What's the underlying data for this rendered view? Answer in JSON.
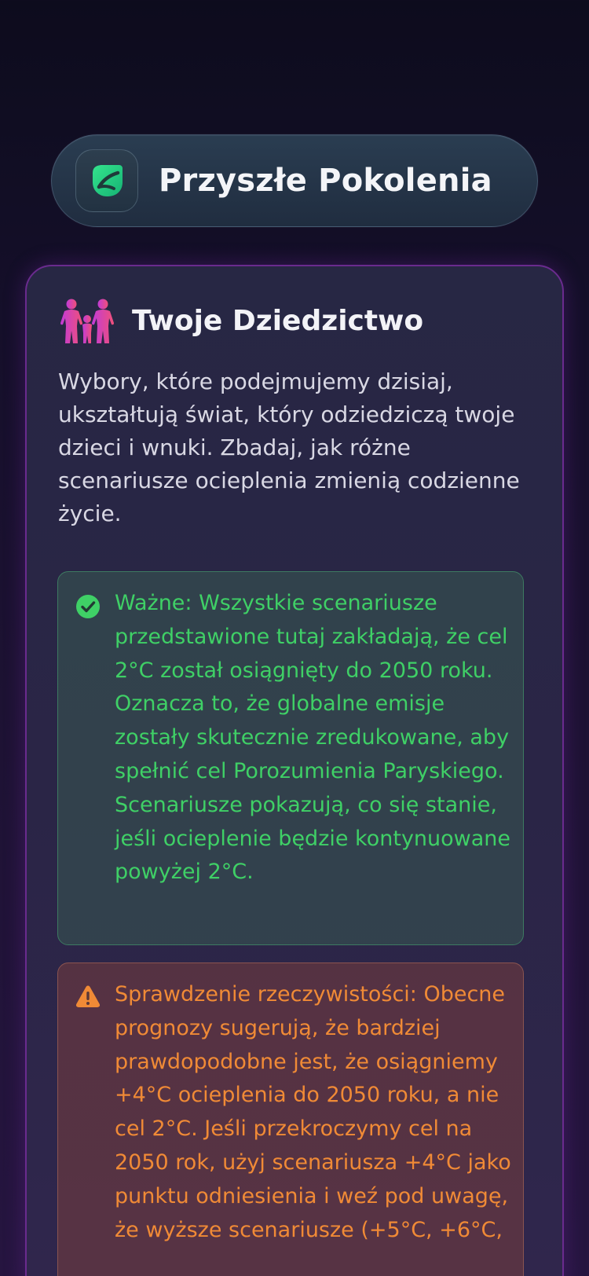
{
  "header": {
    "app_icon": "leaf-icon",
    "title": "Przyszłe Pokolenia"
  },
  "legacy_card": {
    "icon": "family-icon",
    "title": "Twoje Dziedzictwo",
    "description": "Wybory, które podejmujemy dzisiaj, ukształtują świat, który odziedziczą twoje dzieci i wnuki. Zbadaj, jak różne scenariusze ocieplenia zmienią codzienne życie.",
    "important_notice": {
      "icon": "check-circle-icon",
      "text": "Ważne: Wszystkie scenariusze przedstawione tutaj zakładają, że cel 2°C został osiągnięty do 2050 roku. Oznacza to, że globalne emisje zostały skutecznie zredukowane, aby spełnić cel Porozumienia Paryskiego. Scenariusze pokazują, co się stanie, jeśli ocieplenie będzie kontynuowane powyżej 2°C."
    },
    "reality_notice": {
      "icon": "warning-triangle-icon",
      "text": "Sprawdzenie rzeczywistości: Obecne prognozy sugerują, że bardziej prawdopodobne jest, że osiągniemy +4°C ocieplenia do 2050 roku, a nie cel 2°C. Jeśli przekroczymy cel na 2050 rok, użyj scenariusza +4°C jako punktu odniesienia i weź pod uwagę, że wyższe scenariusze (+5°C, +6°C,"
    }
  },
  "colors": {
    "accent_green": "#3fd066",
    "accent_orange": "#f08a36",
    "card_border": "#6a2b8e",
    "family_gradient_start": "#c13bd6",
    "family_gradient_end": "#f0507a"
  }
}
